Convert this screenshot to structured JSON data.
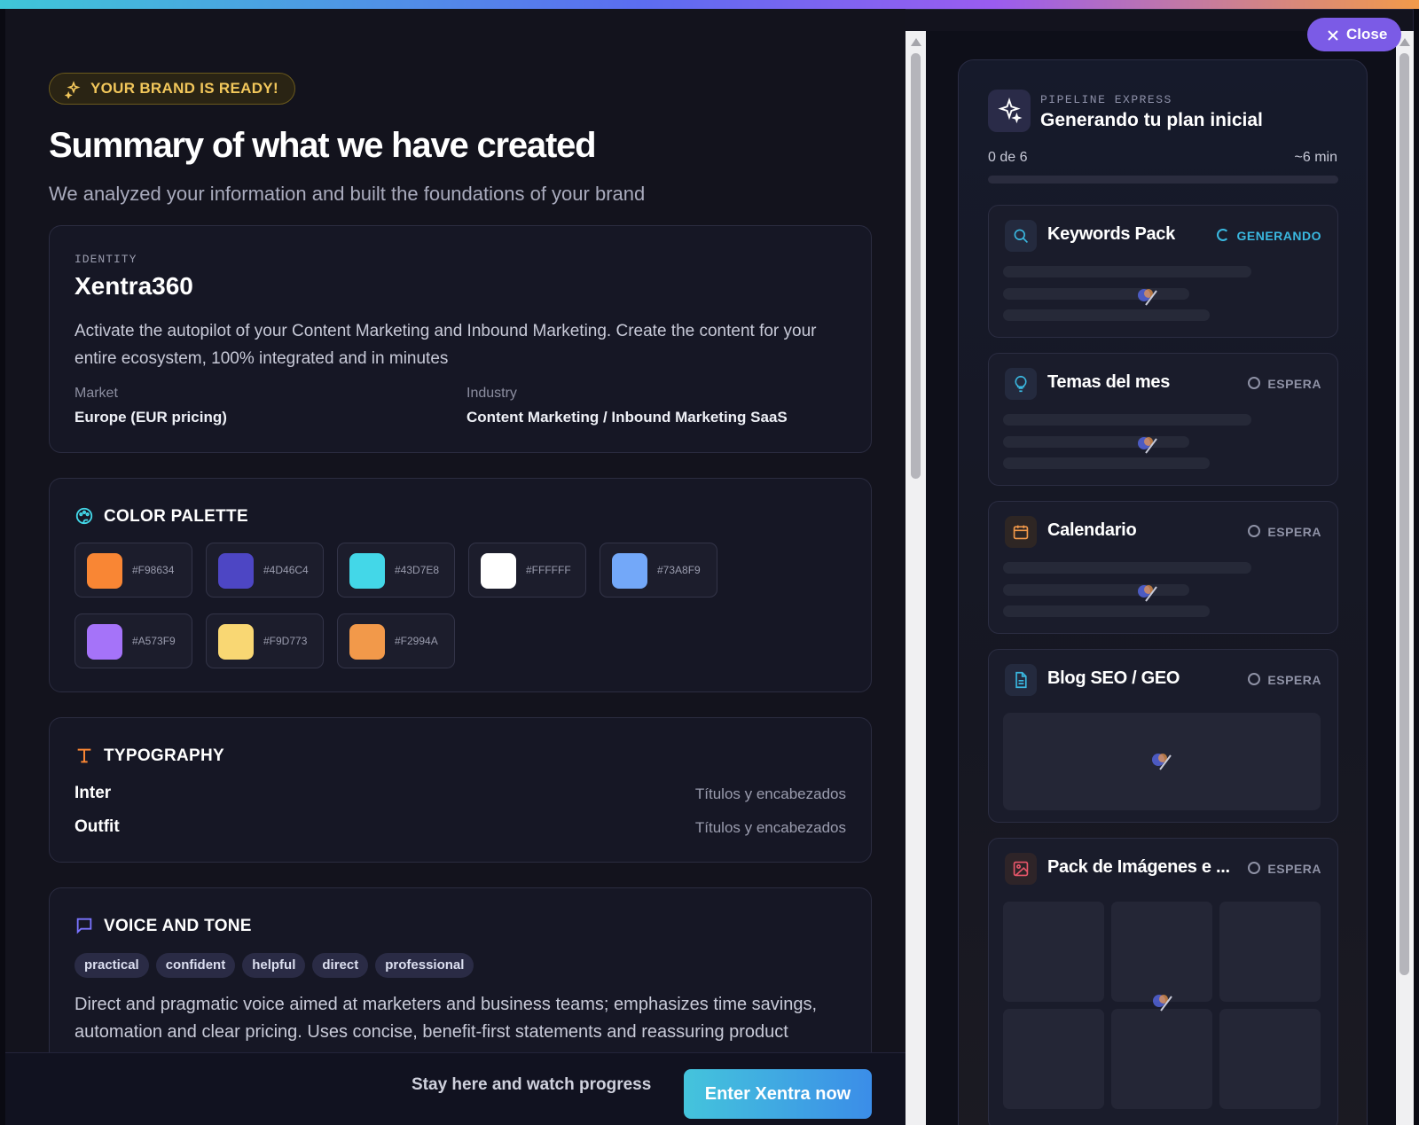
{
  "badge": "YOUR BRAND IS READY!",
  "heading": "Summary of what we have created",
  "subheading": "We analyzed your information and built the foundations of your brand",
  "identity": {
    "label": "IDENTITY",
    "name": "Xentra360",
    "description": "Activate the autopilot of your Content Marketing and Inbound Marketing. Create the content for your entire ecosystem, 100% integrated and in minutes",
    "market_label": "Market",
    "market_value": "Europe (EUR pricing)",
    "industry_label": "Industry",
    "industry_value": "Content Marketing / Inbound Marketing SaaS"
  },
  "palette": {
    "title": "COLOR PALETTE",
    "colors": [
      "#F98634",
      "#4D46C4",
      "#43D7E8",
      "#FFFFFF",
      "#73A8F9",
      "#A573F9",
      "#F9D773",
      "#F2994A"
    ]
  },
  "typography": {
    "title": "TYPOGRAPHY",
    "fonts": [
      {
        "name": "Inter",
        "usage": "Títulos y encabezados"
      },
      {
        "name": "Outfit",
        "usage": "Títulos y encabezados"
      }
    ]
  },
  "voice": {
    "title": "VOICE AND TONE",
    "tags": [
      "practical",
      "confident",
      "helpful",
      "direct",
      "professional"
    ],
    "description": "Direct and pragmatic voice aimed at marketers and business teams; emphasizes time savings, automation and clear pricing. Uses concise, benefit-first statements and reassuring product"
  },
  "footer": {
    "stay_label": "Stay here and watch progress",
    "enter_label": "Enter Xentra now"
  },
  "close_label": "Close",
  "pipeline": {
    "label": "PIPELINE EXPRESS",
    "title": "Generando tu plan inicial",
    "progress_text": "0 de 6",
    "eta": "~6 min",
    "progress": 0.0,
    "steps": [
      {
        "name": "Keywords Pack",
        "status": "GENERANDO",
        "icon": "search-icon"
      },
      {
        "name": "Temas del mes",
        "status": "ESPERA",
        "icon": "lightbulb-icon"
      },
      {
        "name": "Calendario",
        "status": "ESPERA",
        "icon": "calendar-icon"
      },
      {
        "name": "Blog SEO / GEO",
        "status": "ESPERA",
        "icon": "document-icon"
      },
      {
        "name": "Pack de Imágenes e ...",
        "status": "ESPERA",
        "icon": "image-icon"
      }
    ]
  },
  "colors": {
    "accent": "#7b5be6",
    "badge_text": "#f2c75b",
    "generating": "#3ab8e0",
    "enter_button": "#44c4dc"
  }
}
